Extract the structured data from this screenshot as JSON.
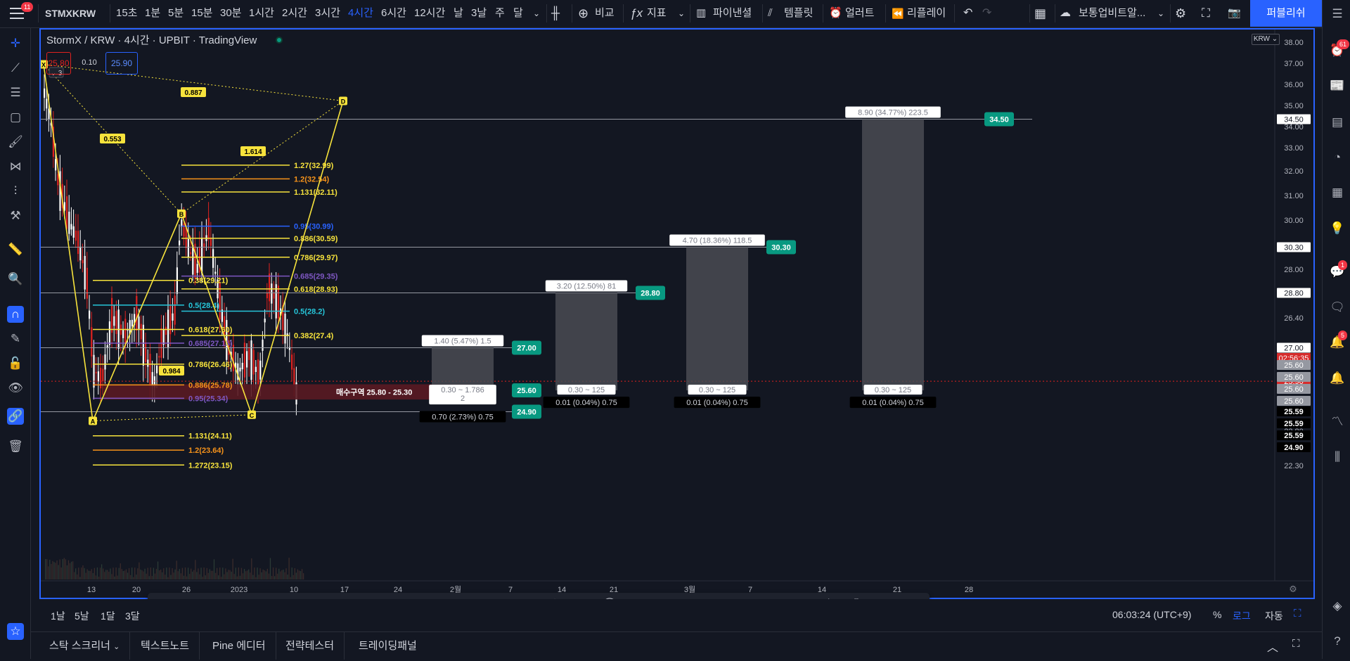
{
  "topbar": {
    "notif_count": "11",
    "symbol": "STMXKRW",
    "intervals": [
      "15초",
      "1분",
      "5분",
      "15분",
      "30분",
      "1시간",
      "2시간",
      "3시간",
      "4시간",
      "6시간",
      "12시간",
      "날",
      "3날",
      "주",
      "달"
    ],
    "active_interval": "4시간",
    "compare": "비교",
    "indicators": "지표",
    "financials": "파이낸셜",
    "templates": "템플릿",
    "alert": "얼러트",
    "replay": "리플레이",
    "layout_name": "보통업비트알...",
    "publish": "퍼블리쉬"
  },
  "legend": {
    "title": "StormX / KRW · 4시간 · UPBIT · TradingView",
    "bid": "25.80",
    "spread": "0.10",
    "ask": "25.90",
    "pattern_label": "3"
  },
  "price_axis": {
    "currency": "KRW",
    "ticks": [
      "38.00",
      "37.00",
      "36.00",
      "35.00",
      "34.00",
      "33.00",
      "32.00",
      "31.00",
      "30.00",
      "29.00",
      "28.00",
      "27.00",
      "26.40",
      "22.80",
      "22.30"
    ],
    "badges": [
      {
        "text": "34.50",
        "kind": "white"
      },
      {
        "text": "30.30",
        "kind": "white"
      },
      {
        "text": "28.80",
        "kind": "white"
      },
      {
        "text": "27.00",
        "kind": "white"
      },
      {
        "text": "25.90",
        "kind": "red"
      },
      {
        "text": "02:56:35",
        "kind": "red"
      },
      {
        "text": "25.60",
        "kind": "gray"
      },
      {
        "text": "25.60",
        "kind": "gray"
      },
      {
        "text": "25.60",
        "kind": "gray"
      },
      {
        "text": "25.60",
        "kind": "gray"
      },
      {
        "text": "25.59",
        "kind": "black"
      },
      {
        "text": "25.59",
        "kind": "black"
      },
      {
        "text": "25.59",
        "kind": "black"
      },
      {
        "text": "24.90",
        "kind": "black"
      }
    ]
  },
  "time_axis": {
    "labels": [
      "13",
      "20",
      "26",
      "2023",
      "10",
      "17",
      "24",
      "2월",
      "7",
      "14",
      "21",
      "3월",
      "7",
      "14",
      "21",
      "28"
    ]
  },
  "annotations": {
    "xabcd": {
      "x": "X",
      "a": "A",
      "b": "B",
      "c": "C",
      "d": "D",
      "r1": "0.887",
      "r2": "0.553",
      "r3": "0.984",
      "r4": "1.614"
    },
    "fib_upper": [
      "1.27(32.99)",
      "1.2(32.54)",
      "1.131(32.11)"
    ],
    "fib_mid": [
      "0.95(30.99)",
      "0.886(30.59)",
      "0.786(29.97)",
      "0.685(29.35)",
      "0.618(28.93)",
      "0.5(28.2)",
      "0.382(27.4)"
    ],
    "fib_left": [
      "0.38(29.21)",
      "0.5(28.4)",
      "0.618(27.60)",
      "0.685(27.15)",
      "0.786(26.46)",
      "0.886(25.78)",
      "0.95(25.34)"
    ],
    "fib_lower": [
      "1.131(24.11)",
      "1.2(23.64)",
      "1.272(23.15)"
    ],
    "buy_zone": "매수구역 25.80 - 25.30",
    "positions": [
      {
        "target": "27.00",
        "top": "1.40 (5.47%) 1.5",
        "mid": "0.30 ~ 1.786",
        "mid2": "2",
        "bottom": "0.70 (2.73%) 0.75",
        "stop": "24.90",
        "entry": "25.60"
      },
      {
        "target": "28.80",
        "top": "3.20 (12.50%) 81",
        "mid": "0.30 ~ 125",
        "bottom": "0.01 (0.04%) 0.75"
      },
      {
        "target": "30.30",
        "top": "4.70 (18.36%) 118.5",
        "mid": "0.30 ~ 125",
        "bottom": "0.01 (0.04%) 0.75"
      },
      {
        "target": "34.50",
        "top": "8.90 (34.77%) 223.5",
        "mid": "0.30 ~ 125",
        "bottom": "0.01 (0.04%) 0.75"
      }
    ]
  },
  "bottombar": {
    "ranges": [
      "1날",
      "5날",
      "1달",
      "3달"
    ],
    "clock": "06:03:24 (UTC+9)",
    "pct": "%",
    "log": "로그",
    "auto": "자동"
  },
  "bottompanel": {
    "tabs": [
      "스탁 스크리너",
      "텍스트노트",
      "Pine 에디터",
      "전략테스터",
      "트레이딩패널"
    ]
  },
  "rightbar": {
    "badges": [
      "61",
      "1",
      "5"
    ]
  },
  "colors": {
    "accent": "#2962ff",
    "up": "#ffffff",
    "down": "#e0221f",
    "teal": "#089981",
    "fib_yellow": "#f7e33c",
    "fib_orange": "#f7931a",
    "fib_purple": "#7e57c2",
    "fib_blue": "#2962ff"
  }
}
